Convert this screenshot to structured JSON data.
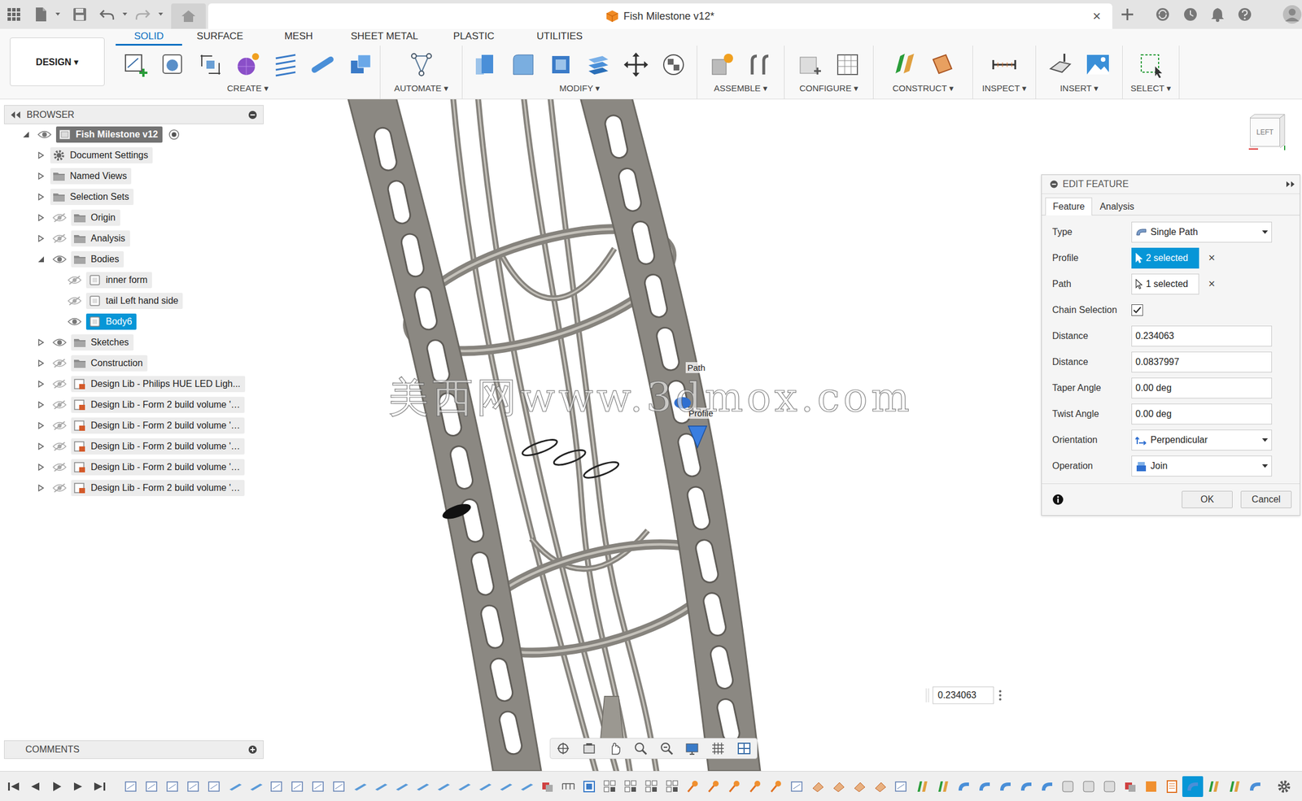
{
  "window": {
    "title": "Fish Milestone v12*",
    "close": "×"
  },
  "workspace": {
    "label": "DESIGN ▾"
  },
  "ribbon_tabs": [
    {
      "label": "SOLID",
      "selected": true
    },
    {
      "label": "SURFACE",
      "selected": false
    },
    {
      "label": "MESH",
      "selected": false
    },
    {
      "label": "SHEET METAL",
      "selected": false
    },
    {
      "label": "PLASTIC",
      "selected": false
    },
    {
      "label": "UTILITIES",
      "selected": false
    }
  ],
  "toolbar_groups": [
    {
      "label": "CREATE ▾"
    },
    {
      "label": "AUTOMATE ▾"
    },
    {
      "label": "MODIFY ▾"
    },
    {
      "label": "ASSEMBLE ▾"
    },
    {
      "label": "CONFIGURE ▾"
    },
    {
      "label": "CONSTRUCT ▾"
    },
    {
      "label": "INSPECT ▾"
    },
    {
      "label": "INSERT ▾"
    },
    {
      "label": "SELECT ▾"
    }
  ],
  "browser": {
    "title": "BROWSER",
    "items": [
      {
        "label": "Fish Milestone v12",
        "level": 0,
        "expandable": true,
        "expanded": true,
        "has_eye": true,
        "visible": true,
        "selected": false,
        "kind": "root"
      },
      {
        "label": "Document Settings",
        "level": 1,
        "expandable": true,
        "expanded": false,
        "has_eye": false,
        "visible": true,
        "selected": false,
        "kind": "gear"
      },
      {
        "label": "Named Views",
        "level": 1,
        "expandable": true,
        "expanded": false,
        "has_eye": false,
        "visible": true,
        "selected": false,
        "kind": "folder"
      },
      {
        "label": "Selection Sets",
        "level": 1,
        "expandable": true,
        "expanded": false,
        "has_eye": false,
        "visible": true,
        "selected": false,
        "kind": "folder"
      },
      {
        "label": "Origin",
        "level": 1,
        "expandable": true,
        "expanded": false,
        "has_eye": true,
        "visible": false,
        "selected": false,
        "kind": "folder"
      },
      {
        "label": "Analysis",
        "level": 1,
        "expandable": true,
        "expanded": false,
        "has_eye": true,
        "visible": false,
        "selected": false,
        "kind": "folder"
      },
      {
        "label": "Bodies",
        "level": 1,
        "expandable": true,
        "expanded": true,
        "has_eye": true,
        "visible": true,
        "selected": false,
        "kind": "folder"
      },
      {
        "label": "inner form",
        "level": 2,
        "expandable": false,
        "expanded": false,
        "has_eye": true,
        "visible": false,
        "selected": false,
        "kind": "body"
      },
      {
        "label": "tail Left hand side",
        "level": 2,
        "expandable": false,
        "expanded": false,
        "has_eye": true,
        "visible": false,
        "selected": false,
        "kind": "body"
      },
      {
        "label": "Body6",
        "level": 2,
        "expandable": false,
        "expanded": false,
        "has_eye": true,
        "visible": true,
        "selected": true,
        "kind": "body"
      },
      {
        "label": "Sketches",
        "level": 1,
        "expandable": true,
        "expanded": false,
        "has_eye": true,
        "visible": true,
        "selected": false,
        "kind": "folder"
      },
      {
        "label": "Construction",
        "level": 1,
        "expandable": true,
        "expanded": false,
        "has_eye": true,
        "visible": false,
        "selected": false,
        "kind": "folder"
      },
      {
        "label": "Design Lib - Philips HUE LED Ligh...",
        "level": 1,
        "expandable": true,
        "expanded": false,
        "has_eye": true,
        "visible": false,
        "selected": false,
        "kind": "component"
      },
      {
        "label": "Design Lib - Form 2 build volume '…",
        "level": 1,
        "expandable": true,
        "expanded": false,
        "has_eye": true,
        "visible": false,
        "selected": false,
        "kind": "component"
      },
      {
        "label": "Design Lib - Form 2 build volume '…",
        "level": 1,
        "expandable": true,
        "expanded": false,
        "has_eye": true,
        "visible": false,
        "selected": false,
        "kind": "component"
      },
      {
        "label": "Design Lib - Form 2 build volume '…",
        "level": 1,
        "expandable": true,
        "expanded": false,
        "has_eye": true,
        "visible": false,
        "selected": false,
        "kind": "component"
      },
      {
        "label": "Design Lib - Form 2 build volume '…",
        "level": 1,
        "expandable": true,
        "expanded": false,
        "has_eye": true,
        "visible": false,
        "selected": false,
        "kind": "component"
      },
      {
        "label": "Design Lib - Form 2 build volume '…",
        "level": 1,
        "expandable": true,
        "expanded": false,
        "has_eye": true,
        "visible": false,
        "selected": false,
        "kind": "component"
      }
    ]
  },
  "comments": {
    "title": "COMMENTS"
  },
  "viewport": {
    "view_cube": "LEFT",
    "labels": [
      {
        "text": "Path"
      },
      {
        "text": "Profile"
      }
    ],
    "watermark": "美西网www.3dmox.com",
    "input": "0.234063"
  },
  "edit_feature": {
    "title": "EDIT FEATURE",
    "tabs": [
      {
        "label": "Feature",
        "selected": true
      },
      {
        "label": "Analysis",
        "selected": false
      }
    ],
    "fields": [
      {
        "label": "Type",
        "kind": "dropdown",
        "value": "Single Path"
      },
      {
        "label": "Profile",
        "kind": "selection",
        "value": "2 selected",
        "active": true,
        "clear": "×"
      },
      {
        "label": "Path",
        "kind": "selection",
        "value": "1 selected",
        "active": false,
        "clear": "×"
      },
      {
        "label": "Chain Selection",
        "kind": "checkbox",
        "checked": true
      },
      {
        "label": "Distance",
        "kind": "input",
        "value": "0.234063"
      },
      {
        "label": "Distance",
        "kind": "input",
        "value": "0.0837997"
      },
      {
        "label": "Taper Angle",
        "kind": "input",
        "value": "0.00 deg"
      },
      {
        "label": "Twist Angle",
        "kind": "input",
        "value": "0.00 deg"
      },
      {
        "label": "Orientation",
        "kind": "dropdown",
        "value": "Perpendicular"
      },
      {
        "label": "Operation",
        "kind": "dropdown",
        "value": "Join"
      }
    ],
    "buttons": [
      {
        "label": "OK"
      },
      {
        "label": "Cancel"
      }
    ]
  },
  "timeline": {
    "items": [
      {
        "kind": "sketch",
        "selected": false
      },
      {
        "kind": "sketch",
        "selected": false
      },
      {
        "kind": "sketch",
        "selected": false
      },
      {
        "kind": "sketch",
        "selected": false
      },
      {
        "kind": "sketch",
        "selected": false
      },
      {
        "kind": "extrude",
        "selected": false
      },
      {
        "kind": "extrude",
        "selected": false
      },
      {
        "kind": "sketch",
        "selected": false
      },
      {
        "kind": "sketch",
        "selected": false
      },
      {
        "kind": "sketch",
        "selected": false
      },
      {
        "kind": "sketch",
        "selected": false
      },
      {
        "kind": "extrude",
        "selected": false
      },
      {
        "kind": "extrude",
        "selected": false
      },
      {
        "kind": "extrude",
        "selected": false
      },
      {
        "kind": "extrude",
        "selected": false
      },
      {
        "kind": "extrude",
        "selected": false
      },
      {
        "kind": "extrude",
        "selected": false
      },
      {
        "kind": "extrude",
        "selected": false
      },
      {
        "kind": "extrude",
        "selected": false
      },
      {
        "kind": "extrude",
        "selected": false
      },
      {
        "kind": "combine",
        "selected": false
      },
      {
        "kind": "group",
        "selected": false
      },
      {
        "kind": "sketchb",
        "selected": false
      },
      {
        "kind": "pattern",
        "selected": false
      },
      {
        "kind": "pattern",
        "selected": false
      },
      {
        "kind": "pattern",
        "selected": false
      },
      {
        "kind": "pattern",
        "selected": false
      },
      {
        "kind": "point",
        "selected": false
      },
      {
        "kind": "point",
        "selected": false
      },
      {
        "kind": "point",
        "selected": false
      },
      {
        "kind": "point",
        "selected": false
      },
      {
        "kind": "point",
        "selected": false
      },
      {
        "kind": "sketch",
        "selected": false
      },
      {
        "kind": "move",
        "selected": false
      },
      {
        "kind": "move",
        "selected": false
      },
      {
        "kind": "move",
        "selected": false
      },
      {
        "kind": "move",
        "selected": false
      },
      {
        "kind": "sketch",
        "selected": false
      },
      {
        "kind": "plane",
        "selected": false
      },
      {
        "kind": "plane",
        "selected": false
      },
      {
        "kind": "sweep",
        "selected": false
      },
      {
        "kind": "sweep",
        "selected": false
      },
      {
        "kind": "sweep",
        "selected": false
      },
      {
        "kind": "sweep",
        "selected": false
      },
      {
        "kind": "sweep",
        "selected": false
      },
      {
        "kind": "shell",
        "selected": false
      },
      {
        "kind": "shell",
        "selected": false
      },
      {
        "kind": "shell",
        "selected": false
      },
      {
        "kind": "combine",
        "selected": false
      },
      {
        "kind": "fill",
        "selected": false
      },
      {
        "kind": "offset",
        "selected": false
      },
      {
        "kind": "sweep",
        "selected": true
      },
      {
        "kind": "plane",
        "selected": false
      },
      {
        "kind": "plane",
        "selected": false
      },
      {
        "kind": "sweep",
        "selected": false
      }
    ]
  }
}
